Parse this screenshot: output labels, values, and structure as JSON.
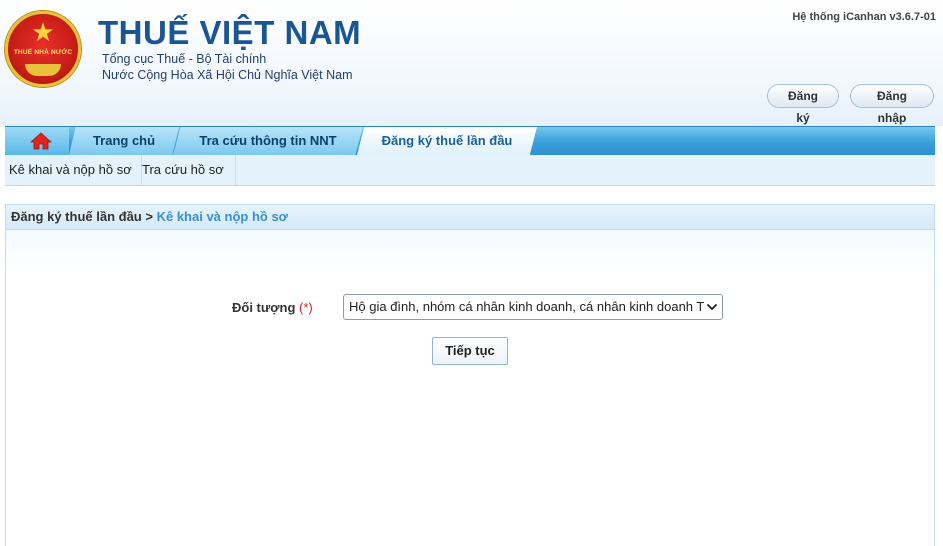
{
  "header": {
    "logo_text": "THUẾ NHÀ NƯỚC",
    "title": "THUẾ VIỆT NAM",
    "subtitle_1": "Tổng cục Thuế - Bộ Tài chính",
    "subtitle_2": "Nước Cộng Hòa Xã Hội Chủ Nghĩa Việt Nam",
    "version": "Hệ thống iCanhan v3.6.7-01",
    "register_label": "Đăng ký",
    "login_label": "Đăng nhập"
  },
  "nav": {
    "home_icon": "home-icon",
    "items": [
      {
        "label": "Trang chủ"
      },
      {
        "label": "Tra cứu thông tin NNT"
      },
      {
        "label": "Đăng ký thuế lần đầu",
        "active": true
      }
    ]
  },
  "subnav": {
    "items": [
      {
        "label": "Kê khai và nộp hồ sơ"
      },
      {
        "label": "Tra cứu hồ sơ"
      }
    ]
  },
  "breadcrumb": {
    "parent": "Đăng ký thuế lần đầu",
    "separator": ">",
    "current": "Kê khai và nộp hồ sơ"
  },
  "form": {
    "doi_tuong_label": "Đối tượng",
    "required_marker": "(*)",
    "doi_tuong_value": "Hộ gia đình, nhóm cá nhân kinh doanh, cá nhân kinh doanh T",
    "continue_label": "Tiếp tục"
  },
  "colors": {
    "brand_blue": "#1a5594",
    "nav_blue": "#3a9fd9",
    "crumb_current": "#3a8fcf",
    "required_red": "#d1232a"
  }
}
